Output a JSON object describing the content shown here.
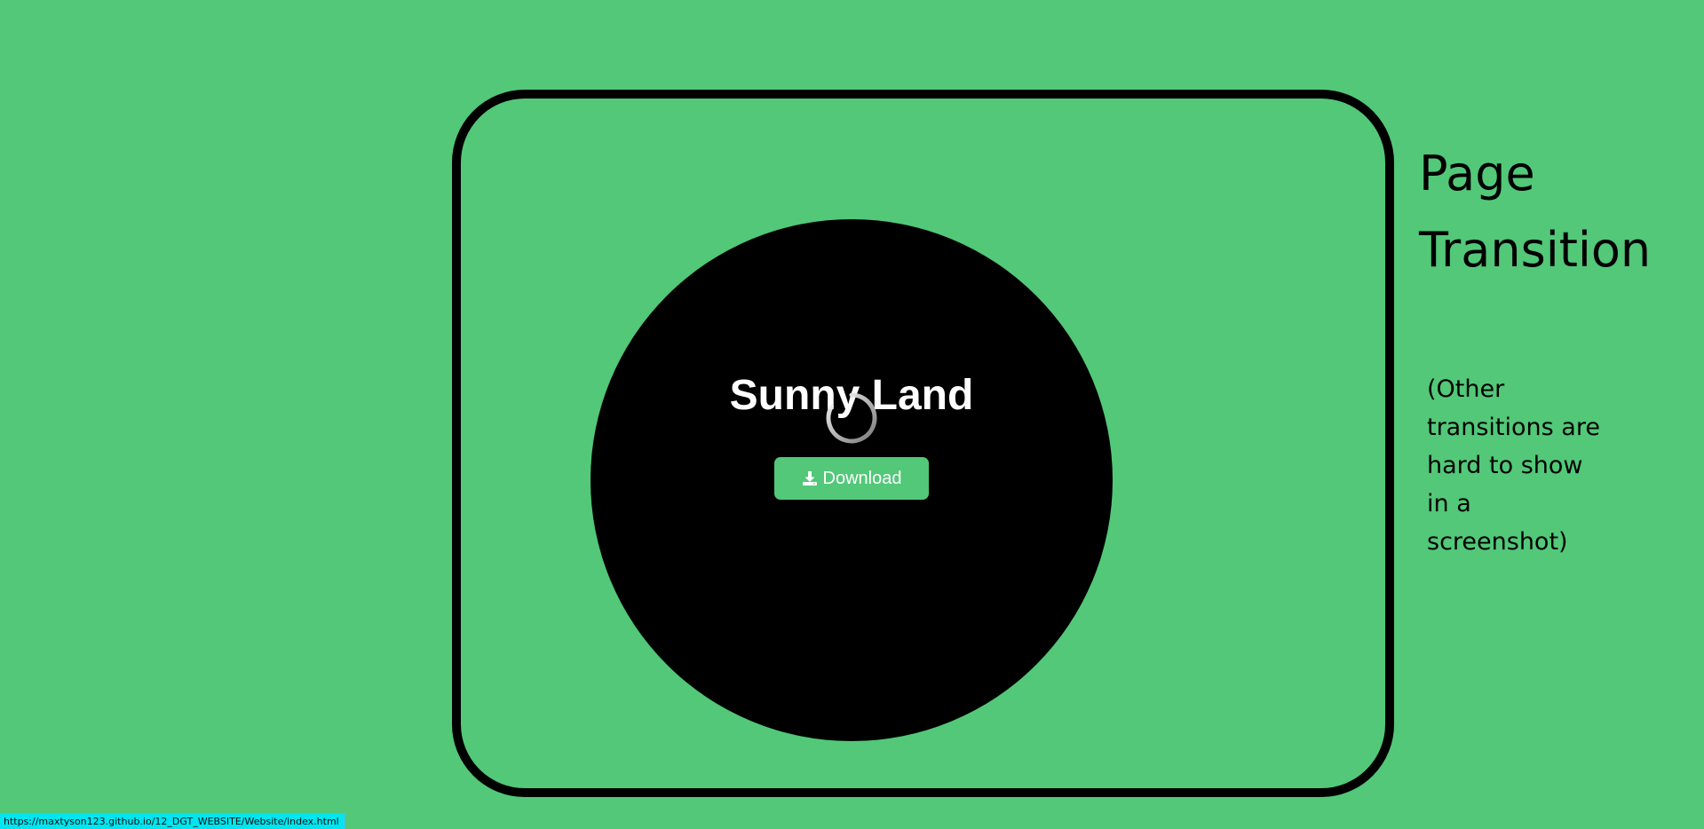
{
  "slide": {
    "title": "Sunny Land",
    "download_label": "Download",
    "download_icon": "download-icon"
  },
  "side_heading": {
    "line1": "Page",
    "line2": "Transition"
  },
  "side_note": {
    "line1": "(Other",
    "line2": "transitions are",
    "line3": "hard to show",
    "line4": "in a",
    "line5": "screenshot)"
  },
  "status_bar": {
    "url": "https://maxtyson123.github.io/12_DGT_WEBSITE/Website/index.html"
  },
  "colors": {
    "background": "#52c878",
    "button": "#52c878",
    "disc": "#000000",
    "frame": "#000000",
    "status_bar": "#00e5f0"
  }
}
